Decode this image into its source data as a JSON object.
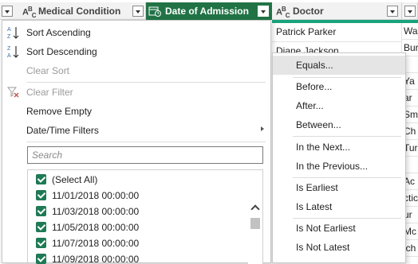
{
  "columns": [
    {
      "type_icon": "ABC",
      "label": "Medical Condition"
    },
    {
      "type_icon": "date",
      "label": "Date of Admission"
    },
    {
      "type_icon": "ABC",
      "label": "Doctor"
    }
  ],
  "accent_color": "#217346",
  "grid": {
    "doctor_cells": [
      "Patrick Parker",
      "Diane Jackson"
    ],
    "next_col_cells": [
      "Wa",
      "Bur",
      "",
      "Ya",
      "ar",
      "Sm",
      "Ch",
      "Tur",
      "",
      "Ac",
      "ctic",
      "ur",
      "Mc",
      "ich"
    ]
  },
  "menu": {
    "sort_ascending": "Sort Ascending",
    "sort_descending": "Sort Descending",
    "clear_sort": "Clear Sort",
    "clear_filter": "Clear Filter",
    "remove_empty": "Remove Empty",
    "datetime_filters": "Date/Time Filters",
    "search_placeholder": "Search",
    "values": [
      "(Select All)",
      "11/01/2018 00:00:00",
      "11/03/2018 00:00:00",
      "11/05/2018 00:00:00",
      "11/07/2018 00:00:00",
      "11/09/2018 00:00:00"
    ]
  },
  "submenu": {
    "items": [
      "Equals...",
      "Before...",
      "After...",
      "Between...",
      "In the Next...",
      "In the Previous...",
      "Is Earliest",
      "Is Latest",
      "Is Not Earliest",
      "Is Not Latest"
    ]
  }
}
